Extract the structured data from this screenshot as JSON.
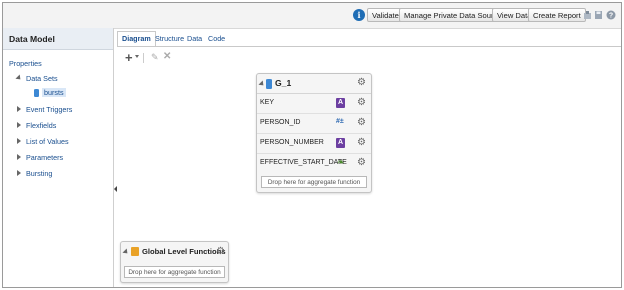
{
  "toolbar": {
    "info_symbol": "i",
    "validate": "Validate",
    "manage_private_sources": "Manage Private Data Sources",
    "view_data": "View Data",
    "create_report": "Create Report",
    "icons": [
      "info-icon",
      "export-icon",
      "save-icon",
      "help-icon"
    ]
  },
  "left_panel": {
    "title": "Data Model",
    "items": [
      {
        "label": "Properties"
      },
      {
        "label": "Data Sets"
      },
      {
        "label": "bursts"
      },
      {
        "label": "Event Triggers"
      },
      {
        "label": "Flexfields"
      },
      {
        "label": "List of Values"
      },
      {
        "label": "Parameters"
      },
      {
        "label": "Bursting"
      }
    ]
  },
  "tabs": [
    "Diagram",
    "Structure",
    "Data",
    "Code"
  ],
  "active_tab": "Diagram",
  "diagram_tools": {
    "add": "+",
    "edit": "✎",
    "delete": "✕"
  },
  "group": {
    "title": "G_1",
    "fields": [
      {
        "name": "KEY",
        "type": "A"
      },
      {
        "name": "PERSON_ID",
        "type": "#±"
      },
      {
        "name": "PERSON_NUMBER",
        "type": "A"
      },
      {
        "name": "EFFECTIVE_START_DATE",
        "type": "date"
      }
    ],
    "drop_label": "Drop here for aggregate function"
  },
  "global_functions": {
    "title": "Global Level Functions",
    "drop_label": "Drop here for aggregate function"
  },
  "colors": {
    "accent_blue": "#1f6db5",
    "link_blue": "#1a4f8f",
    "string_badge": "#6c3fa1",
    "folder": "#e9a227"
  }
}
